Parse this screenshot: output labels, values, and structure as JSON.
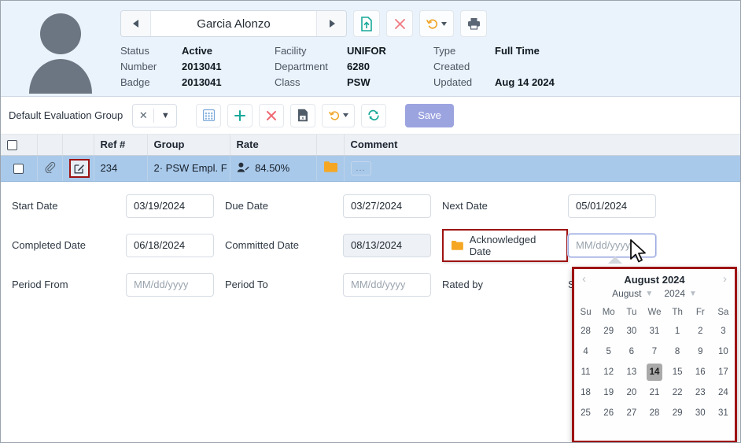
{
  "employee": {
    "name": "Garcia Alonzo",
    "avatar_icon": "person-avatar-icon",
    "nav_prev_icon": "triangle-left-icon",
    "nav_next_icon": "triangle-right-icon",
    "buttons": [
      {
        "name": "upload-document-button",
        "icon": "file-upload-icon"
      },
      {
        "name": "delete-button",
        "icon": "x-icon"
      },
      {
        "name": "history-button",
        "icon": "history-clock-icon"
      },
      {
        "name": "print-button",
        "icon": "printer-icon"
      }
    ],
    "fields": [
      {
        "label": "Status",
        "value": "Active"
      },
      {
        "label": "Facility",
        "value": "UNIFOR"
      },
      {
        "label": "Type",
        "value": "Full Time"
      },
      {
        "label": "Number",
        "value": "2013041"
      },
      {
        "label": "Department",
        "value": "6280"
      },
      {
        "label": "Created",
        "value": ""
      },
      {
        "label": "Badge",
        "value": "2013041"
      },
      {
        "label": "Class",
        "value": "PSW"
      },
      {
        "label": "Updated",
        "value": "Aug 14 2024"
      }
    ]
  },
  "toolbar": {
    "group_label": "Default Evaluation Group",
    "clear_icon": "x-icon",
    "chevron_icon": "chevron-down-icon",
    "save_label": "Save",
    "buttons": [
      {
        "name": "grid-view-button",
        "icon": "grid-icon"
      },
      {
        "name": "add-button",
        "icon": "plus-icon"
      },
      {
        "name": "remove-button",
        "icon": "x-icon"
      },
      {
        "name": "export-excel-button",
        "icon": "excel-file-icon"
      },
      {
        "name": "history-button",
        "icon": "history-clock-icon"
      },
      {
        "name": "refresh-button",
        "icon": "refresh-icon"
      }
    ]
  },
  "grid": {
    "columns": [
      "",
      "",
      "",
      "Ref #",
      "Group",
      "Rate",
      "",
      "Comment"
    ],
    "rows": [
      {
        "ref": "234",
        "group": "2· PSW Empl. F",
        "rate": "84.50%",
        "attachment_icon": "paperclip-icon",
        "edit_icon": "edit-pencil-icon",
        "rate_icon": "person-edit-icon",
        "folder_icon": "folder-icon",
        "comment_button": "..."
      }
    ]
  },
  "form": {
    "rows": [
      [
        {
          "label": "Start Date",
          "value": "03/19/2024",
          "placeholder": "MM/dd/yyyy"
        },
        {
          "label": "Due Date",
          "value": "03/27/2024",
          "placeholder": "MM/dd/yyyy"
        },
        {
          "label": "Next Date",
          "value": "05/01/2024",
          "placeholder": "MM/dd/yyyy"
        }
      ],
      [
        {
          "label": "Completed Date",
          "value": "06/18/2024",
          "placeholder": "MM/dd/yyyy"
        },
        {
          "label": "Committed Date",
          "value": "08/13/2024",
          "placeholder": "MM/dd/yyyy"
        },
        {
          "label": "Acknowledged Date",
          "value": "",
          "placeholder": "MM/dd/yyyy"
        }
      ],
      [
        {
          "label": "Period From",
          "value": "",
          "placeholder": "MM/dd/yyyy"
        },
        {
          "label": "Period To",
          "value": "",
          "placeholder": "MM/dd/yyyy"
        },
        {
          "label": "Rated by",
          "value": "Se",
          "placeholder": ""
        }
      ]
    ],
    "acknowledged_folder_icon": "folder-icon"
  },
  "datepicker": {
    "title": "August 2024",
    "month": "August",
    "year": "2024",
    "prev_icon": "chevron-left-icon",
    "next_icon": "chevron-right-icon",
    "weekdays": [
      "Su",
      "Mo",
      "Tu",
      "We",
      "Th",
      "Fr",
      "Sa"
    ],
    "weeks": [
      [
        "28",
        "29",
        "30",
        "31",
        "1",
        "2",
        "3"
      ],
      [
        "4",
        "5",
        "6",
        "7",
        "8",
        "9",
        "10"
      ],
      [
        "11",
        "12",
        "13",
        "14",
        "15",
        "16",
        "17"
      ],
      [
        "18",
        "19",
        "20",
        "21",
        "22",
        "23",
        "24"
      ],
      [
        "25",
        "26",
        "27",
        "28",
        "29",
        "30",
        "31"
      ]
    ],
    "selected_day": "14"
  },
  "colors": {
    "header_bg": "#eaf2fb",
    "row_selected": "#a9c9ea",
    "save_button": "#9ca4e0",
    "highlight_border": "#9e1313",
    "folder": "#f5a623",
    "accent_teal": "#18a999"
  }
}
